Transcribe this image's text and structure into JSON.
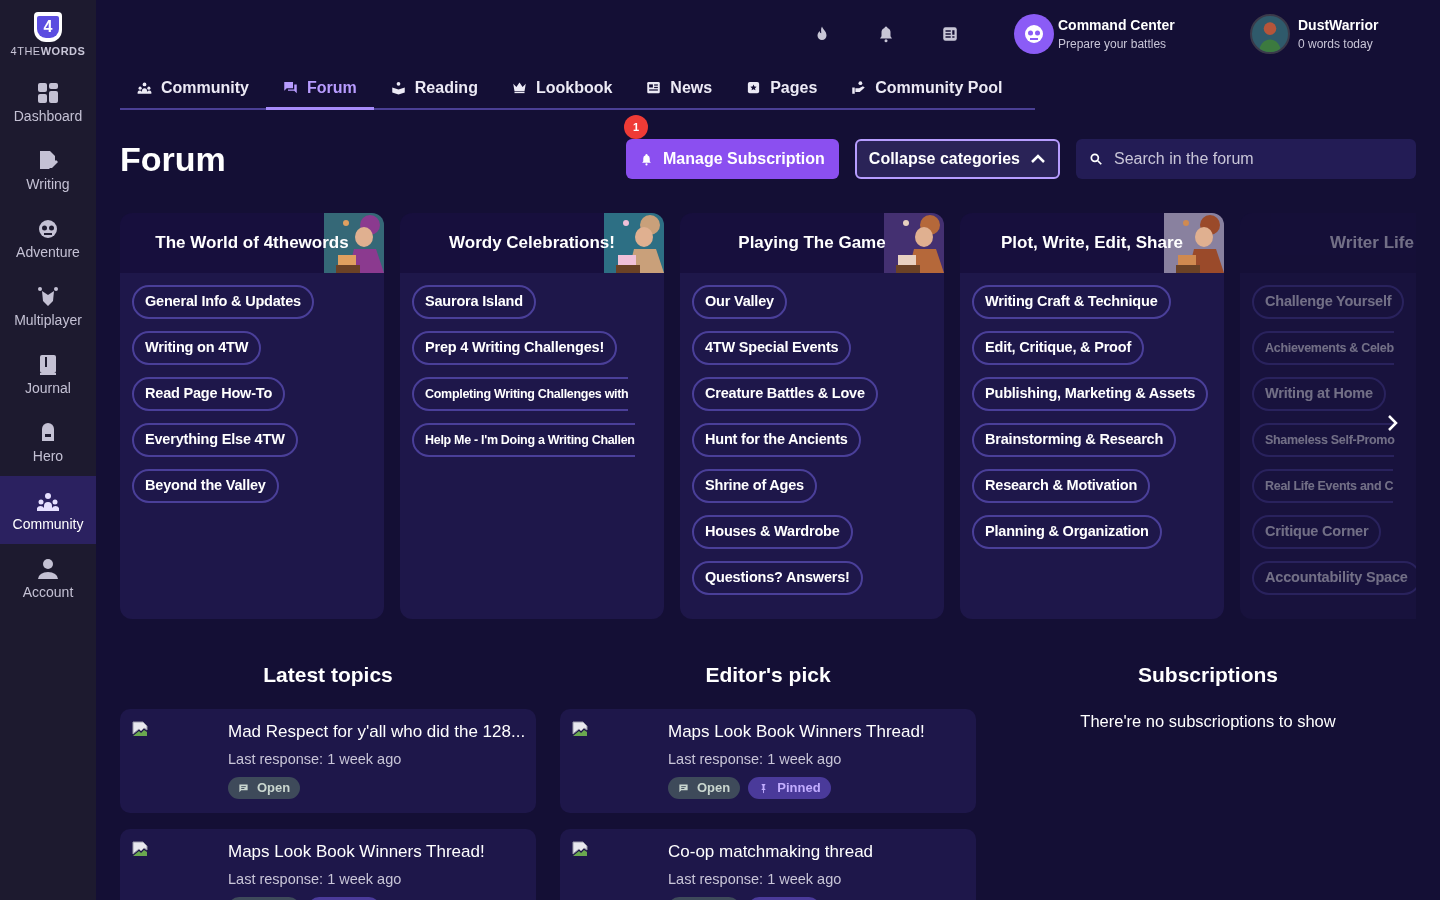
{
  "logo": {
    "mark": "4",
    "wordmark": "4THE**WORDS**"
  },
  "sidebar": {
    "items": [
      {
        "label": "Dashboard",
        "selected": false
      },
      {
        "label": "Writing",
        "selected": false
      },
      {
        "label": "Adventure",
        "selected": false
      },
      {
        "label": "Multiplayer",
        "selected": false
      },
      {
        "label": "Journal",
        "selected": false
      },
      {
        "label": "Hero",
        "selected": false
      },
      {
        "label": "Community",
        "selected": true
      },
      {
        "label": "Account",
        "selected": false
      }
    ]
  },
  "header": {
    "command_center": {
      "title": "Command Center",
      "subtitle": "Prepare your battles"
    },
    "user": {
      "name": "DustWarrior",
      "subtitle": "0 words today"
    }
  },
  "tabs": [
    {
      "label": "Community",
      "selected": false
    },
    {
      "label": "Forum",
      "selected": true
    },
    {
      "label": "Reading",
      "selected": false
    },
    {
      "label": "Lookbook",
      "selected": false
    },
    {
      "label": "News",
      "selected": false
    },
    {
      "label": "Pages",
      "selected": false
    },
    {
      "label": "Community Pool",
      "selected": false
    }
  ],
  "page_title": "Forum",
  "manage_button": {
    "label": "Manage Subscription",
    "badge": "1"
  },
  "collapse_button": {
    "label": "Collapse categories"
  },
  "search": {
    "placeholder": "Search in the forum"
  },
  "categories": [
    {
      "title": "The World of 4thewords",
      "picture": true,
      "faded": false,
      "topics": [
        {
          "label": "General Info & Updates"
        },
        {
          "label": "Writing on 4TW"
        },
        {
          "label": "Read Page How-To"
        },
        {
          "label": "Everything Else 4TW"
        },
        {
          "label": "Beyond the Valley"
        }
      ]
    },
    {
      "title": "Wordy Celebrations!",
      "picture": true,
      "faded": false,
      "topics": [
        {
          "label": "Saurora Island"
        },
        {
          "label": "Prep 4 Writing Challenges!"
        },
        {
          "label": "Completing Writing Challenges with",
          "cut": true
        },
        {
          "label": "Help Me - I'm Doing a Writing Challen",
          "cut": true
        }
      ]
    },
    {
      "title": "Playing The Game",
      "picture": true,
      "faded": false,
      "topics": [
        {
          "label": "Our Valley"
        },
        {
          "label": "4TW Special Events"
        },
        {
          "label": "Creature Battles & Love"
        },
        {
          "label": "Hunt for the Ancients"
        },
        {
          "label": "Shrine of Ages"
        },
        {
          "label": "Houses & Wardrobe"
        },
        {
          "label": "Questions? Answers!"
        }
      ]
    },
    {
      "title": "Plot, Write, Edit, Share",
      "picture": true,
      "faded": false,
      "topics": [
        {
          "label": "Writing Craft & Technique"
        },
        {
          "label": "Edit, Critique, & Proof"
        },
        {
          "label": "Publishing, Marketing & Assets"
        },
        {
          "label": "Brainstorming & Research"
        },
        {
          "label": "Research & Motivation"
        },
        {
          "label": "Planning & Organization"
        }
      ]
    },
    {
      "title": "Writer Life",
      "picture": false,
      "faded": true,
      "topics": [
        {
          "label": "Challenge Yourself"
        },
        {
          "label": "Achievements & Celeb",
          "cut": true
        },
        {
          "label": "Writing at Home"
        },
        {
          "label": "Shameless Self-Promo",
          "cut": true
        },
        {
          "label": "Real Life Events and C",
          "cut": true
        },
        {
          "label": "Critique Corner"
        },
        {
          "label": "Accountability Space"
        }
      ]
    }
  ],
  "latest_topics": {
    "title": "Latest topics",
    "items": [
      {
        "title": "Mad Respect for y'all who did the 128...",
        "meta": "Last response: 1 week ago",
        "badges": [
          {
            "kind": "open",
            "label": "Open"
          }
        ]
      },
      {
        "title": "Maps Look Book Winners Thread!",
        "meta": "Last response: 1 week ago",
        "badges": [
          {
            "kind": "open"
          },
          {
            "kind": "pinned"
          }
        ]
      }
    ]
  },
  "editors_pick": {
    "title": "Editor's pick",
    "items": [
      {
        "title": "Maps Look Book Winners Thread!",
        "meta": "Last response: 1 week ago",
        "badges": [
          {
            "kind": "open",
            "label": "Open"
          },
          {
            "kind": "pinned",
            "label": "Pinned"
          }
        ]
      },
      {
        "title": "Co-op matchmaking thread",
        "meta": "Last response: 1 week ago",
        "badges": [
          {
            "kind": "open"
          },
          {
            "kind": "pinned"
          }
        ]
      }
    ]
  },
  "subscriptions": {
    "title": "Subscriptions",
    "empty_message": "There're no subscrioptions to show"
  }
}
